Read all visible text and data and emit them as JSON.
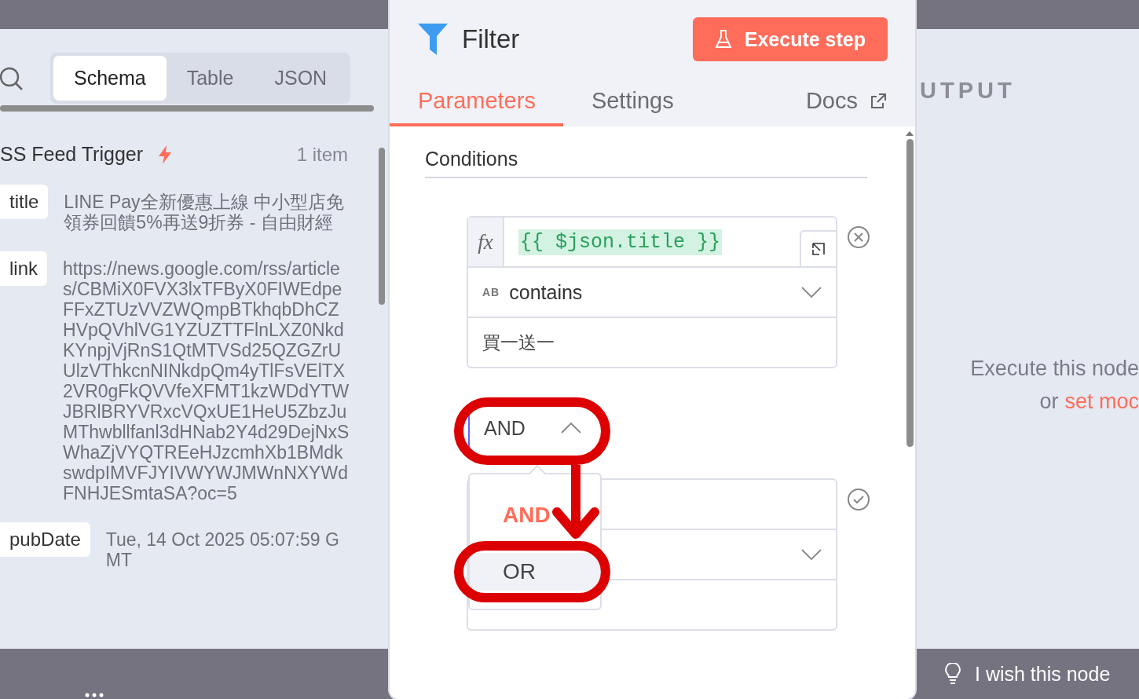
{
  "input_panel": {
    "view_tabs": [
      {
        "label": "Schema",
        "selected": true
      },
      {
        "label": "Table",
        "selected": false
      },
      {
        "label": "JSON",
        "selected": false
      }
    ],
    "node": {
      "name": "SS Feed Trigger",
      "count": "1 item"
    },
    "fields": [
      {
        "key": "title",
        "value": "LINE Pay全新優惠上線 中小型店免領券回饋5%再送9折券 - 自由財經"
      },
      {
        "key": "link",
        "value": "https://news.google.com/rss/articles/CBMiX0FVX3lxTFByX0FIWEdpeFFxZTUzVVZWQmpBTkhqbDhCZHVpQVhlVG1YZUZTTFlnLXZ0NkdKYnpjVjRnS1QtMTVSd25QZGZrUUlzVThkcnNINkdpQm4yTlFsVElTX2VR0gFkQVVfeXFMT1kzWDdYTWJBRlBRYVRxcVQxUE1HeU5ZbzJuMThwbllfanl3dHNab2Y4d29DejNxSWhaZjVYQTREeHJzcmhXb1BMdkswdpIMVFJYIVWYWJMWnNXYWdFNHJESmtaSA?oc=5"
      },
      {
        "key": "pubDate",
        "value": "Tue, 14 Oct 2025 05:07:59 GMT"
      }
    ]
  },
  "node_panel": {
    "title": "Filter",
    "execute_button": "Execute step",
    "tabs": [
      {
        "label": "Parameters",
        "selected": true,
        "kind": "tab"
      },
      {
        "label": "Settings",
        "selected": false,
        "kind": "tab"
      },
      {
        "label": "Docs",
        "selected": false,
        "kind": "link"
      }
    ],
    "conditions": {
      "label": "Conditions",
      "items": [
        {
          "kind": "filled",
          "mode_label": "fx",
          "left_value": "{{ $json.title }}",
          "operator_type": "AB",
          "operator": "contains",
          "right_value": "買一送一"
        },
        {
          "kind": "empty"
        }
      ],
      "combinator": {
        "value": "AND",
        "expanded": true,
        "options": [
          {
            "label": "AND",
            "selected": true,
            "hovered": false
          },
          {
            "label": "OR",
            "selected": false,
            "hovered": true
          }
        ]
      }
    }
  },
  "output_panel": {
    "title": "UTPUT",
    "message": "Execute this node",
    "hint_prefix": "or",
    "hint_link": "set moc"
  },
  "footer": {
    "feedback": "I wish this node"
  },
  "annotations": [
    {
      "kind": "ring"
    },
    {
      "kind": "arrow"
    },
    {
      "kind": "ring"
    }
  ]
}
